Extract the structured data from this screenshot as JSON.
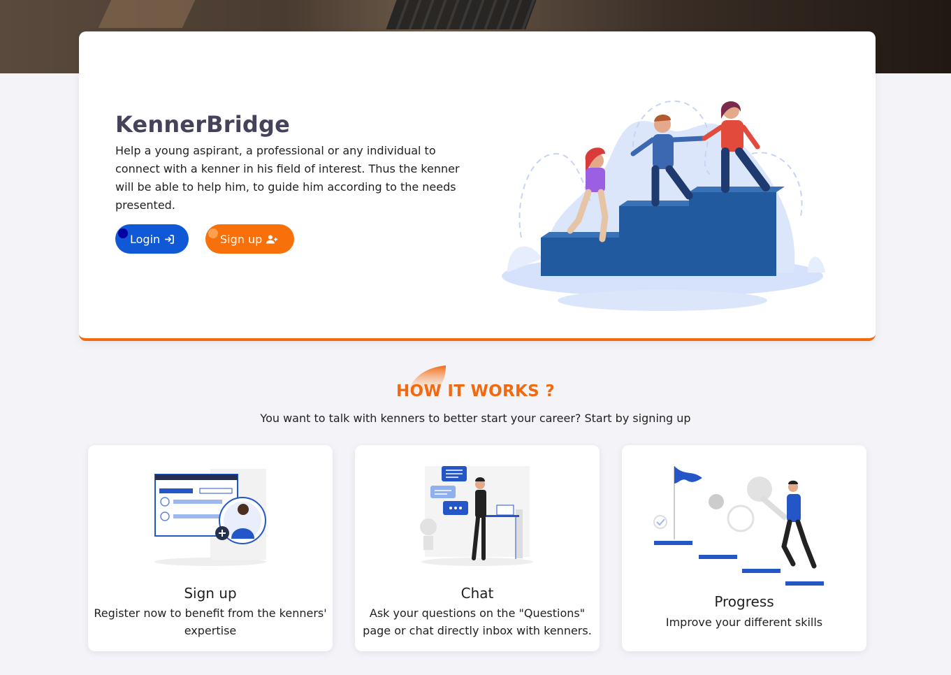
{
  "hero": {
    "title": "KennerBridge",
    "description": "Help a young aspirant, a professional or any individual to connect with a kenner in his field of interest. Thus the kenner will be able to help him, to guide him according to the needs presented.",
    "login_label": "Login",
    "signup_label": "Sign up"
  },
  "how_it_works": {
    "title": "HOW IT WORKS ?",
    "subtitle": "You want to talk with kenners to better start your career? Start by signing up",
    "cards": [
      {
        "title": "Sign up",
        "text": "Register now to benefit from the kenners' expertise",
        "icon": "signup-illustration"
      },
      {
        "title": "Chat",
        "text": "Ask your questions on the \"Questions\" page or chat directly inbox with kenners.",
        "icon": "chat-illustration"
      },
      {
        "title": "Progress",
        "text": "Improve your different skills",
        "icon": "progress-illustration"
      }
    ]
  },
  "colors": {
    "primary_blue": "#0f58d6",
    "accent_orange": "#f7700a",
    "background": "#f3f3f8"
  }
}
